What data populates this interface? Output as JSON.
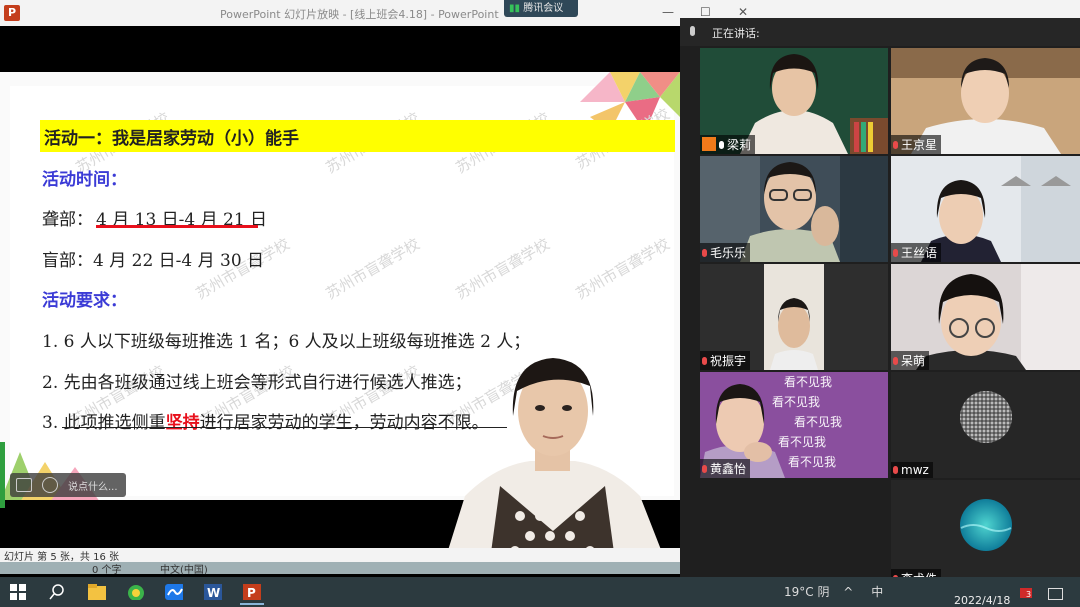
{
  "window": {
    "ppt_logo": "P",
    "title": "PowerPoint 幻灯片放映 - [线上班会4.18] - PowerPoint",
    "meeting_app": "腾讯会议",
    "controls": [
      "—",
      "☐",
      "✕"
    ]
  },
  "slide": {
    "watermark": "苏州市盲聋学校",
    "heading": "活动一：我是居家劳动（小）能手",
    "time_label": "活动时间：",
    "deaf_prefix": "聋部：",
    "deaf_dates": "4 月 13 日-4 月 21 日",
    "blind_line": "盲部：4 月 22 日-4 月 30 日",
    "req_label": "活动要求：",
    "req1": "1. 6 人以下班级每班推选 1 名；6 人及以上班级每班推选 2 人；",
    "req2": "2. 先由各班级通过线上班会等形式自行进行候选人推选；",
    "req3_pre": "3. ",
    "req3_a": "此项推选侧重",
    "req3_b": "坚持",
    "req3_c": "进行居家劳动的学生，劳动内容不限。",
    "colors": {
      "highlight": "#ffff00",
      "blue": "#3b3bd6",
      "red": "#e8101c"
    }
  },
  "comment_box": {
    "placeholder": "说点什么..."
  },
  "status_bar": {
    "slide_info": "幻灯片 第 5 张，共 16 张",
    "word_count": "0 个字",
    "language": "中文(中国)"
  },
  "meeting": {
    "speaking_label": "正在讲话:",
    "participants": [
      {
        "name": "梁莉",
        "mic": "on",
        "host": true
      },
      {
        "name": "王京星",
        "mic": "muted"
      },
      {
        "name": "毛乐乐",
        "mic": "muted"
      },
      {
        "name": "王丝语",
        "mic": "muted"
      },
      {
        "name": "祝振宇",
        "mic": "muted"
      },
      {
        "name": "呆萌",
        "mic": "muted"
      },
      {
        "name": "黄鑫怡",
        "mic": "muted",
        "bg_text": "看不见我"
      },
      {
        "name": "mwz",
        "mic": "muted"
      },
      {
        "name": "李术佚",
        "mic": "muted"
      }
    ]
  },
  "taskbar": {
    "weather": "19°C 阴",
    "ime": "中",
    "date": "2022/4/18",
    "notification_count": "3",
    "apps": [
      "windows-start",
      "search",
      "file-explorer",
      "360-browser",
      "tencent-meeting",
      "word",
      "powerpoint"
    ]
  }
}
